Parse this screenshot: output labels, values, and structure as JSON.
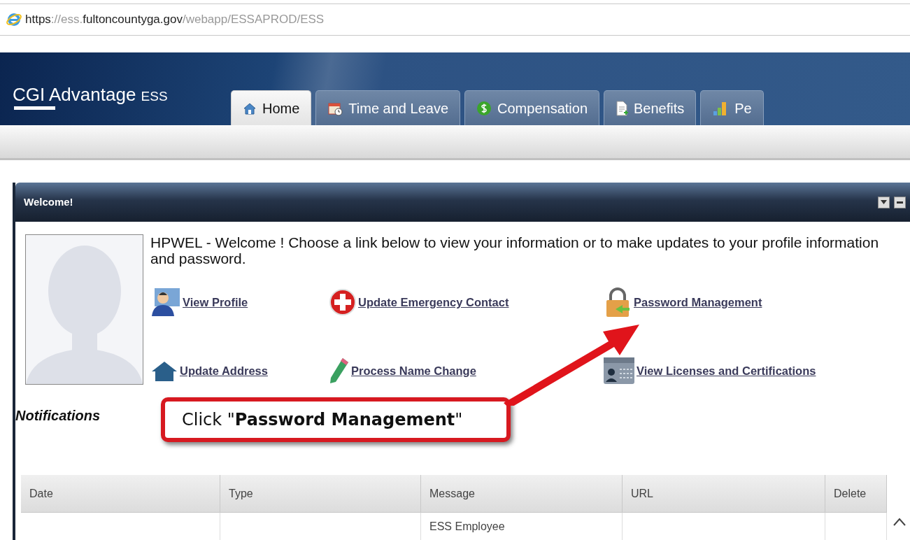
{
  "address_bar": {
    "url_parts": [
      {
        "text": "https",
        "emphasis": true
      },
      {
        "text": "://ess.",
        "emphasis": false
      },
      {
        "text": "fultoncountyga.gov",
        "emphasis": true
      },
      {
        "text": "/webapp/ESSAPROD/ESS",
        "emphasis": false
      }
    ]
  },
  "header": {
    "logo_main": "CGI Advantage",
    "logo_sub": "ESS"
  },
  "tabs": [
    {
      "label": "Home",
      "kind": "house",
      "selected": true
    },
    {
      "label": "Time and Leave",
      "kind": "calendar",
      "selected": false
    },
    {
      "label": "Compensation",
      "kind": "dollar",
      "selected": false
    },
    {
      "label": "Benefits",
      "kind": "document",
      "selected": false
    },
    {
      "label": "Pe",
      "kind": "chart",
      "selected": false
    }
  ],
  "welcome_panel": {
    "title": "Welcome!",
    "intro": "HPWEL - Welcome ! Choose a link below to view your information or to make updates to your profile information and password.",
    "links": [
      {
        "label": "View Profile",
        "kind": "person"
      },
      {
        "label": "Update Emergency Contact",
        "kind": "cross"
      },
      {
        "label": "Password Management",
        "kind": "lock"
      },
      {
        "label": "Update Address",
        "kind": "house"
      },
      {
        "label": "Process Name Change",
        "kind": "pencil"
      },
      {
        "label": "View Licenses and Certifications",
        "kind": "card"
      }
    ],
    "notifications_title": "Notifications",
    "table": {
      "columns": [
        "Date",
        "Type",
        "Message",
        "URL",
        "Delete"
      ],
      "rows": [
        [
          "",
          "",
          "ESS Employee",
          "",
          ""
        ]
      ]
    }
  },
  "callout": {
    "text": "Click \"**Password Management**\""
  }
}
